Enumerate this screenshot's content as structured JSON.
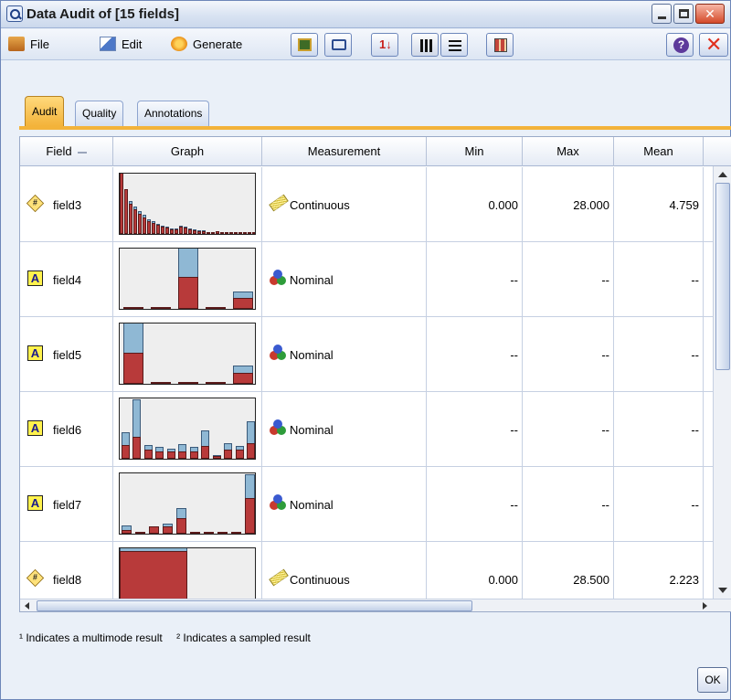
{
  "window": {
    "title": "Data Audit of [15 fields]"
  },
  "menu": {
    "file": "File",
    "edit": "Edit",
    "generate": "Generate"
  },
  "tabs": [
    {
      "label": "Audit",
      "active": true
    },
    {
      "label": "Quality",
      "active": false
    },
    {
      "label": "Annotations",
      "active": false
    }
  ],
  "columns": {
    "field": "Field",
    "graph": "Graph",
    "measurement": "Measurement",
    "min": "Min",
    "max": "Max",
    "mean": "Mean"
  },
  "rows": [
    {
      "field": "field3",
      "type_icon": "numeric-icon",
      "measurement": "Continuous",
      "min": "0.000",
      "max": "28.000",
      "mean": "4.759"
    },
    {
      "field": "field4",
      "type_icon": "string-icon",
      "measurement": "Nominal",
      "min": "--",
      "max": "--",
      "mean": "--"
    },
    {
      "field": "field5",
      "type_icon": "string-icon",
      "measurement": "Nominal",
      "min": "--",
      "max": "--",
      "mean": "--"
    },
    {
      "field": "field6",
      "type_icon": "string-icon",
      "measurement": "Nominal",
      "min": "--",
      "max": "--",
      "mean": "--"
    },
    {
      "field": "field7",
      "type_icon": "string-icon",
      "measurement": "Nominal",
      "min": "--",
      "max": "--",
      "mean": "--"
    },
    {
      "field": "field8",
      "type_icon": "numeric-icon",
      "measurement": "Continuous",
      "min": "0.000",
      "max": "28.500",
      "mean": "2.223"
    }
  ],
  "graphs": [
    {
      "kind": "histogram",
      "bars": [
        [
          0.0,
          0.98
        ],
        [
          0.0,
          0.72
        ],
        [
          0.05,
          0.48
        ],
        [
          0.04,
          0.4
        ],
        [
          0.05,
          0.33
        ],
        [
          0.04,
          0.27
        ],
        [
          0.03,
          0.21
        ],
        [
          0.03,
          0.18
        ],
        [
          0.02,
          0.14
        ],
        [
          0.02,
          0.12
        ],
        [
          0.02,
          0.1
        ],
        [
          0.02,
          0.08
        ],
        [
          0.02,
          0.08
        ],
        [
          0.02,
          0.12
        ],
        [
          0.02,
          0.1
        ],
        [
          0.01,
          0.08
        ],
        [
          0.01,
          0.06
        ],
        [
          0.01,
          0.05
        ],
        [
          0.01,
          0.04
        ],
        [
          0.0,
          0.03
        ],
        [
          0.0,
          0.03
        ],
        [
          0.0,
          0.04
        ],
        [
          0.0,
          0.03
        ],
        [
          0.0,
          0.02
        ],
        [
          0.0,
          0.02
        ],
        [
          0.0,
          0.02
        ],
        [
          0.0,
          0.01
        ],
        [
          0.0,
          0.01
        ],
        [
          0.0,
          0.01
        ],
        [
          0.0,
          0.01
        ]
      ]
    },
    {
      "kind": "bars",
      "bars": [
        [
          0.0,
          0.02
        ],
        [
          0.0,
          0.0
        ],
        [
          0.48,
          0.52
        ],
        [
          0.0,
          0.0
        ],
        [
          0.1,
          0.18
        ]
      ]
    },
    {
      "kind": "bars",
      "bars": [
        [
          0.48,
          0.5
        ],
        [
          0.0,
          0.02
        ],
        [
          0.0,
          0.02
        ],
        [
          0.0,
          0.0
        ],
        [
          0.12,
          0.18
        ]
      ]
    },
    {
      "kind": "bars",
      "bars": [
        [
          0.2,
          0.22
        ],
        [
          0.6,
          0.35
        ],
        [
          0.07,
          0.15
        ],
        [
          0.08,
          0.12
        ],
        [
          0.05,
          0.12
        ],
        [
          0.12,
          0.12
        ],
        [
          0.07,
          0.12
        ],
        [
          0.25,
          0.2
        ],
        [
          0.02,
          0.04
        ],
        [
          0.1,
          0.15
        ],
        [
          0.06,
          0.15
        ],
        [
          0.35,
          0.25
        ]
      ]
    },
    {
      "kind": "bars",
      "bars": [
        [
          0.08,
          0.06
        ],
        [
          0.0,
          0.03
        ],
        [
          0.0,
          0.12
        ],
        [
          0.05,
          0.12
        ],
        [
          0.16,
          0.25
        ],
        [
          0.0,
          0.03
        ],
        [
          0.0,
          0.03
        ],
        [
          0.0,
          0.03
        ],
        [
          0.0,
          0.03
        ],
        [
          0.38,
          0.58
        ]
      ]
    },
    {
      "kind": "histogram",
      "bars": [
        [
          0.2,
          0.92
        ],
        [
          0.0,
          0.05
        ]
      ]
    }
  ],
  "footnote": {
    "multimode": "¹ Indicates a multimode result",
    "sampled": "² Indicates a sampled result"
  },
  "buttons": {
    "ok": "OK"
  },
  "colors": {
    "bar_top": "#8fb8d4",
    "bar_bottom": "#b83a3a",
    "active_tab": "#f3b33a"
  }
}
